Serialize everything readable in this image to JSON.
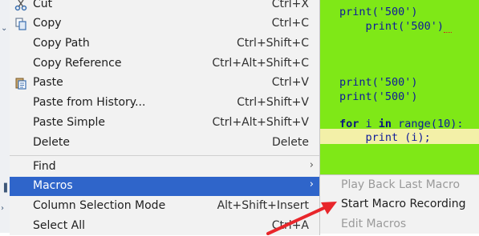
{
  "editor": {
    "lines": [
      {
        "text": "print('500')",
        "style": "plain"
      },
      {
        "text": "    print('500')",
        "style": "plain"
      },
      {
        "text": "print('500')",
        "style": "plain"
      },
      {
        "text": "print('500')",
        "style": "plain"
      },
      {
        "kw1": "for",
        "mid1": " i ",
        "kw2": "in",
        "rest": " range(10):",
        "style": "for"
      },
      {
        "text": "    print (i);",
        "style": "plain"
      }
    ],
    "background_color": "#7fe817",
    "highlight_color": "#f3f0a8"
  },
  "context_menu": {
    "items": [
      {
        "label": "Cut",
        "shortcut": "Ctrl+X",
        "icon": "scissors-icon"
      },
      {
        "label": "Copy",
        "shortcut": "Ctrl+C",
        "icon": "copy-icon"
      },
      {
        "label": "Copy Path",
        "shortcut": "Ctrl+Shift+C"
      },
      {
        "label": "Copy Reference",
        "shortcut": "Ctrl+Alt+Shift+C"
      },
      {
        "label": "Paste",
        "shortcut": "Ctrl+V",
        "icon": "paste-icon"
      },
      {
        "label": "Paste from History...",
        "shortcut": "Ctrl+Shift+V"
      },
      {
        "label": "Paste Simple",
        "shortcut": "Ctrl+Alt+Shift+V"
      },
      {
        "label": "Delete",
        "shortcut": "Delete"
      },
      {
        "label": "Find",
        "submenu": true
      },
      {
        "label": "Macros",
        "submenu": true,
        "active": true
      },
      {
        "label": "Column Selection Mode",
        "shortcut": "Alt+Shift+Insert"
      },
      {
        "label": "Select All",
        "shortcut": "Ctrl+A"
      }
    ]
  },
  "macros_submenu": {
    "items": [
      {
        "label": "Play Back Last Macro",
        "enabled": false
      },
      {
        "label": "Start Macro Recording",
        "enabled": true
      },
      {
        "label": "Edit Macros",
        "enabled": false
      }
    ]
  },
  "colors": {
    "menu_bg": "#f2f2f2",
    "selection": "#2f65ca",
    "annotation_arrow": "#e8262b"
  }
}
